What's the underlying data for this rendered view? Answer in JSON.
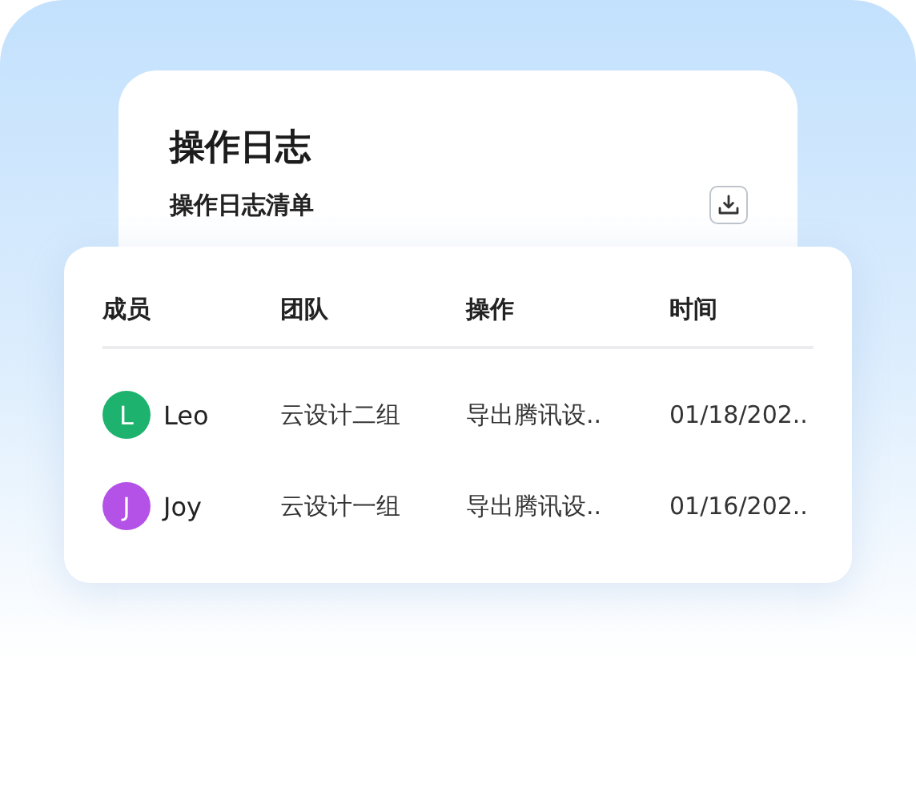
{
  "card": {
    "title": "操作日志",
    "subtitle": "操作日志清单"
  },
  "table": {
    "columns": [
      "成员",
      "团队",
      "操作",
      "时间"
    ],
    "rows": [
      {
        "avatar": "L",
        "color": "#1db36e",
        "member": "Leo",
        "team": "云设计二组",
        "action": "导出腾讯设..",
        "time": "01/18/202.."
      },
      {
        "avatar": "J",
        "color": "#b452e8",
        "member": "Joy",
        "team": "云设计一组",
        "action": "导出腾讯设..",
        "time": "01/16/202.."
      }
    ]
  }
}
